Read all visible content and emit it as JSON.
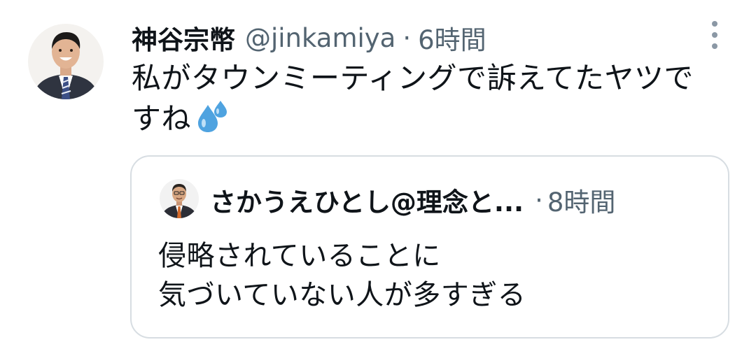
{
  "tweet": {
    "author": {
      "display_name": "神谷宗幣",
      "handle": "@jinkamiya",
      "avatar_icon": "avatar-photo"
    },
    "separator": "·",
    "time": "6時間",
    "text_lines": [
      "私がタウンミーティングで訴えてたヤツで",
      "すね"
    ],
    "emoji": "sweat-droplets-emoji",
    "more_icon": "more-vertical-icon"
  },
  "quoted_tweet": {
    "author": {
      "display_name": "さかうえひとし@理念と...",
      "avatar_icon": "avatar-photo"
    },
    "separator": "·",
    "time": "8時間",
    "text_lines": [
      "侵略されていることに",
      "気づいていない人が多すぎる"
    ]
  },
  "colors": {
    "text": "#0f1419",
    "secondary": "#536471",
    "border": "#d7dde2",
    "emoji_blue": "#4fa3e0"
  }
}
